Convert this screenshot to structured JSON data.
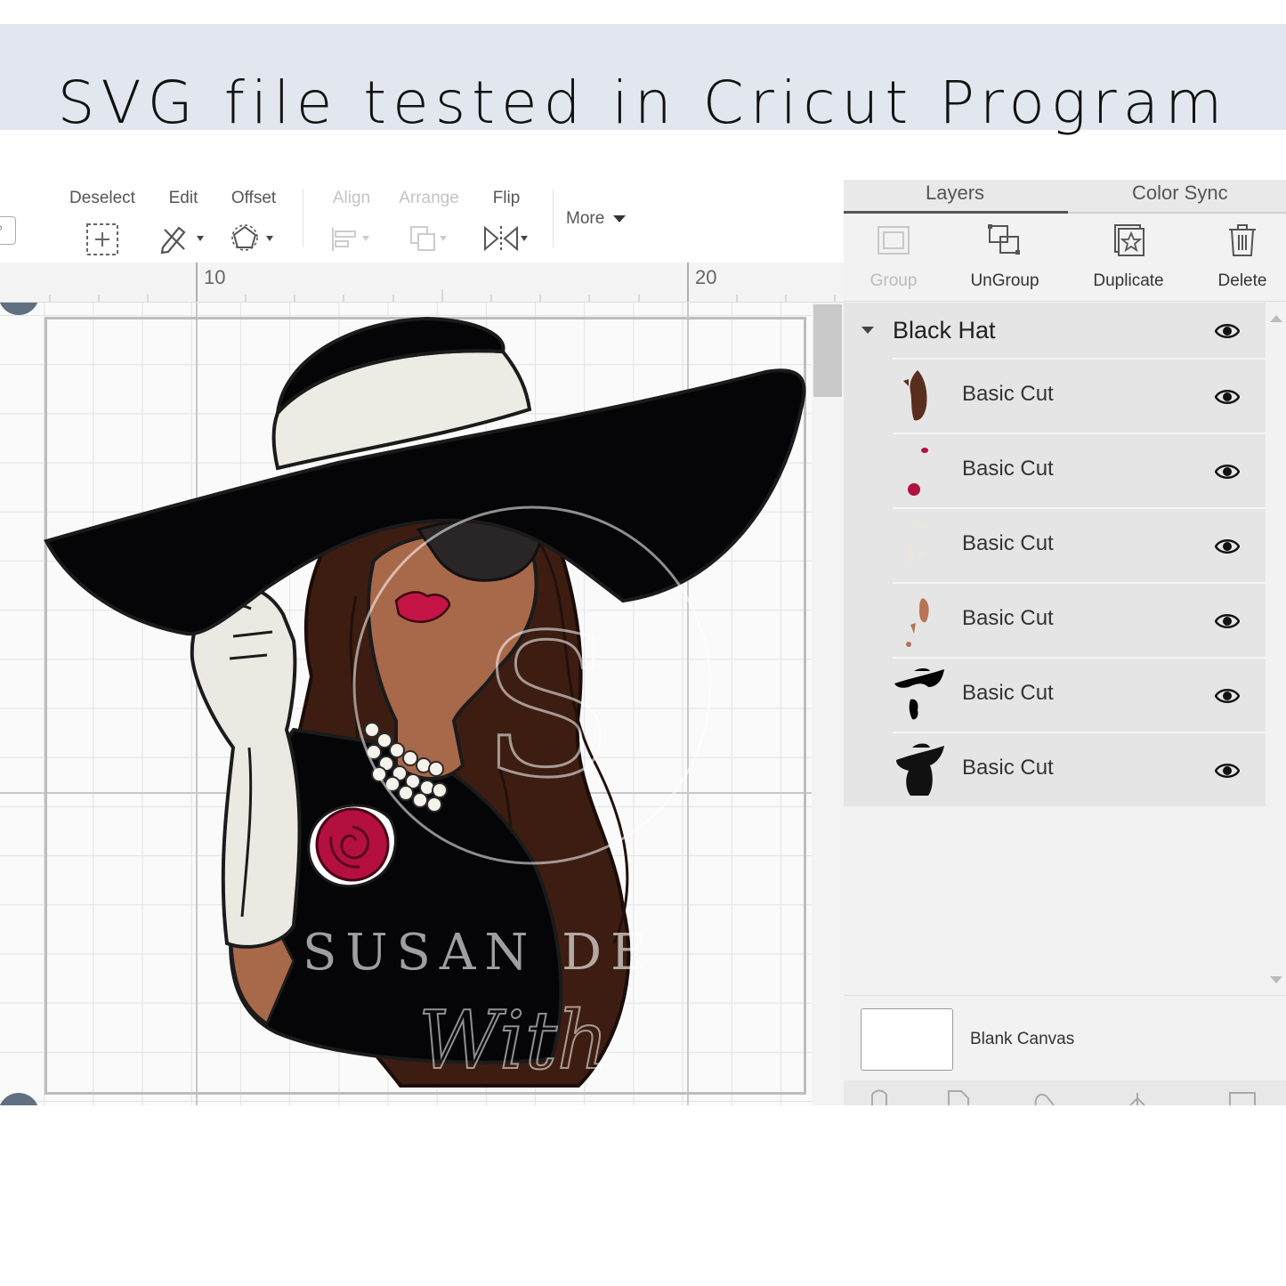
{
  "banner": {
    "title": "SVG file tested in Cricut Program"
  },
  "toolbar": {
    "deselect": "Deselect",
    "edit": "Edit",
    "offset": "Offset",
    "align": "Align",
    "arrange": "Arrange",
    "flip": "Flip",
    "more": "More",
    "left_stub": "?"
  },
  "ruler": {
    "labels": [
      "10",
      "20"
    ]
  },
  "canvas": {
    "watermark": "SUSAN DE",
    "watermark_monogram": "S",
    "watermark_script": "With"
  },
  "panel": {
    "tabs": [
      "Layers",
      "Color Sync"
    ],
    "actions": [
      {
        "label": "Group",
        "enabled": false,
        "icon": "group-icon"
      },
      {
        "label": "UnGroup",
        "enabled": true,
        "icon": "ungroup-icon"
      },
      {
        "label": "Duplicate",
        "enabled": true,
        "icon": "duplicate-icon"
      },
      {
        "label": "Delete",
        "enabled": true,
        "icon": "trash-icon"
      }
    ],
    "group_name": "Black Hat",
    "layers": [
      {
        "name": "Basic Cut",
        "thumb_color": "#5a2e1e"
      },
      {
        "name": "Basic Cut",
        "thumb_color": "#b0123f"
      },
      {
        "name": "Basic Cut",
        "thumb_color": "#e8e6df"
      },
      {
        "name": "Basic Cut",
        "thumb_color": "#b87354"
      },
      {
        "name": "Basic Cut",
        "thumb_color": "#050505"
      },
      {
        "name": "Basic Cut",
        "thumb_color": "#111111"
      }
    ],
    "blank_canvas": "Blank Canvas"
  },
  "colors": {
    "banner_bg": "#e2e7ef",
    "hat_black": "#050508",
    "hat_band": "#ecebe4",
    "hair": "#3d1d12",
    "skin": "#a8684a",
    "lips": "#c41445",
    "rose": "#b4103f",
    "glove": "#eae9e2"
  }
}
